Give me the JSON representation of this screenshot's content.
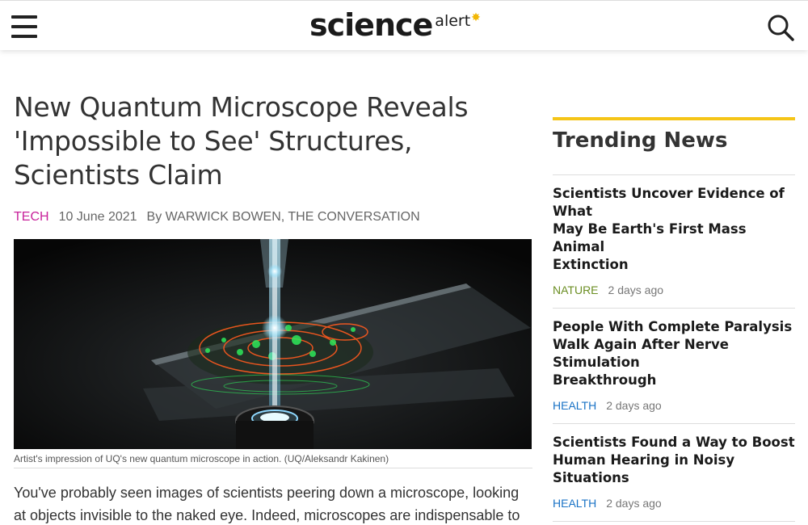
{
  "header": {
    "logo_main": "science",
    "logo_sub": "alert",
    "menu_icon": "hamburger-menu-icon",
    "search_icon": "search-icon"
  },
  "article": {
    "headline_lines": [
      "New Quantum Microscope Reveals",
      "'Impossible to See' Structures,",
      "Scientists Claim"
    ],
    "category": "TECH",
    "category_color": "#c8229b",
    "date": "10 June 2021",
    "byline": "By WARWICK BOWEN, THE CONVERSATION",
    "image_caption": "Artist's impression of UQ's new quantum microscope in action. (UQ/Aleksandr Kakinen)",
    "body_lines": [
      "You've probably seen images of scientists peering down a microscope, looking",
      "at objects invisible to the naked eye. Indeed, microscopes are indispensable to"
    ]
  },
  "sidebar": {
    "title": "Trending News",
    "accent_color": "#f5c518",
    "items": [
      {
        "title_lines": [
          "Scientists Uncover Evidence of What",
          "May Be Earth's First Mass Animal",
          "Extinction"
        ],
        "category": "NATURE",
        "category_color": "#6b8e23",
        "time": "2 days ago"
      },
      {
        "title_lines": [
          "People With Complete Paralysis",
          "Walk Again After Nerve Stimulation",
          "Breakthrough"
        ],
        "category": "HEALTH",
        "category_color": "#1a73c6",
        "time": "2 days ago"
      },
      {
        "title_lines": [
          "Scientists Found a Way to Boost",
          "Human Hearing in Noisy Situations"
        ],
        "category": "HEALTH",
        "category_color": "#1a73c6",
        "time": "2 days ago"
      }
    ]
  }
}
